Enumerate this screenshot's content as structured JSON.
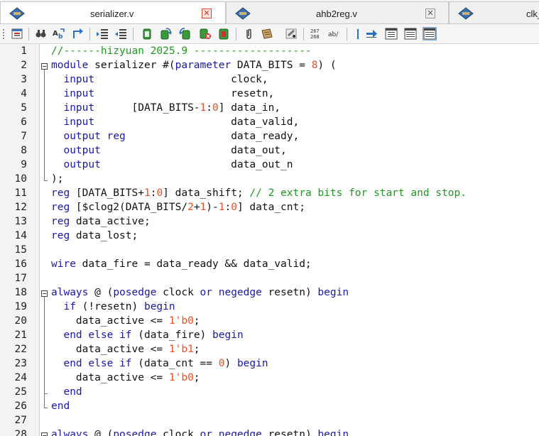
{
  "tabs": [
    {
      "label": "serializer.v",
      "active": true,
      "close_style": "red"
    },
    {
      "label": "ahb2reg.v",
      "active": false,
      "close_style": "grey"
    },
    {
      "label": "clk_",
      "active": false,
      "close_style": "none"
    }
  ],
  "toolbar": {
    "icons": [
      "new-file-icon",
      "find-icon",
      "replace-icon",
      "goto-icon",
      "indent-icon",
      "outdent-icon",
      "copy-icon",
      "paste-icon",
      "cut-icon",
      "delete-icon",
      "clipboard-icon",
      "attach-icon",
      "scroll-icon",
      "tag-icon",
      "hex-icon",
      "ab-icon",
      "line-icon",
      "arrow-right-icon",
      "split-view-icon",
      "list-view-icon",
      "wrap-view-icon"
    ],
    "hex_label_top": "267",
    "hex_label_bottom": "268",
    "ab_label": "ab/"
  },
  "colors": {
    "keyword": "#1a1aa6",
    "number": "#e8502a",
    "comment": "#1f9a1f",
    "text": "#111111"
  },
  "editor": {
    "lines": [
      {
        "n": "1",
        "tokens": [
          {
            "t": "//------hizyuan 2025.9 -------------------",
            "c": "cm"
          }
        ]
      },
      {
        "n": "2",
        "tokens": [
          {
            "t": "module",
            "c": "kw"
          },
          {
            "t": " serializer #("
          },
          {
            "t": "parameter",
            "c": "kw"
          },
          {
            "t": " DATA_BITS = "
          },
          {
            "t": "8",
            "c": "num"
          },
          {
            "t": ") ("
          }
        ]
      },
      {
        "n": "3",
        "tokens": [
          {
            "t": "  "
          },
          {
            "t": "input",
            "c": "kw"
          },
          {
            "t": "                      clock,"
          }
        ]
      },
      {
        "n": "4",
        "tokens": [
          {
            "t": "  "
          },
          {
            "t": "input",
            "c": "kw"
          },
          {
            "t": "                      resetn,"
          }
        ]
      },
      {
        "n": "5",
        "tokens": [
          {
            "t": "  "
          },
          {
            "t": "input",
            "c": "kw"
          },
          {
            "t": "      [DATA_BITS-"
          },
          {
            "t": "1",
            "c": "num"
          },
          {
            "t": ":"
          },
          {
            "t": "0",
            "c": "num"
          },
          {
            "t": "] data_in,"
          }
        ]
      },
      {
        "n": "6",
        "tokens": [
          {
            "t": "  "
          },
          {
            "t": "input",
            "c": "kw"
          },
          {
            "t": "                      data_valid,"
          }
        ]
      },
      {
        "n": "7",
        "tokens": [
          {
            "t": "  "
          },
          {
            "t": "output",
            "c": "kw"
          },
          {
            "t": " "
          },
          {
            "t": "reg",
            "c": "kw"
          },
          {
            "t": "                 data_ready,"
          }
        ]
      },
      {
        "n": "8",
        "tokens": [
          {
            "t": "  "
          },
          {
            "t": "output",
            "c": "kw"
          },
          {
            "t": "                     data_out,"
          }
        ]
      },
      {
        "n": "9",
        "tokens": [
          {
            "t": "  "
          },
          {
            "t": "output",
            "c": "kw"
          },
          {
            "t": "                     data_out_n"
          }
        ]
      },
      {
        "n": "10",
        "tokens": [
          {
            "t": ");"
          }
        ]
      },
      {
        "n": "11",
        "tokens": [
          {
            "t": "reg",
            "c": "kw"
          },
          {
            "t": " [DATA_BITS+"
          },
          {
            "t": "1",
            "c": "num"
          },
          {
            "t": ":"
          },
          {
            "t": "0",
            "c": "num"
          },
          {
            "t": "] data_shift; "
          },
          {
            "t": "// 2 extra bits for start and stop.",
            "c": "cm"
          }
        ]
      },
      {
        "n": "12",
        "tokens": [
          {
            "t": "reg",
            "c": "kw"
          },
          {
            "t": " [$clog2(DATA_BITS/"
          },
          {
            "t": "2",
            "c": "num"
          },
          {
            "t": "+"
          },
          {
            "t": "1",
            "c": "num"
          },
          {
            "t": ")-"
          },
          {
            "t": "1",
            "c": "num"
          },
          {
            "t": ":"
          },
          {
            "t": "0",
            "c": "num"
          },
          {
            "t": "] data_cnt;"
          }
        ]
      },
      {
        "n": "13",
        "tokens": [
          {
            "t": "reg",
            "c": "kw"
          },
          {
            "t": " data_active;"
          }
        ]
      },
      {
        "n": "14",
        "tokens": [
          {
            "t": "reg",
            "c": "kw"
          },
          {
            "t": " data_lost;"
          }
        ]
      },
      {
        "n": "15",
        "tokens": []
      },
      {
        "n": "16",
        "tokens": [
          {
            "t": "wire",
            "c": "kw"
          },
          {
            "t": " data_fire = data_ready && data_valid;"
          }
        ]
      },
      {
        "n": "17",
        "tokens": []
      },
      {
        "n": "18",
        "tokens": [
          {
            "t": "always",
            "c": "kw"
          },
          {
            "t": " @ ("
          },
          {
            "t": "posedge",
            "c": "kw"
          },
          {
            "t": " clock "
          },
          {
            "t": "or",
            "c": "kw"
          },
          {
            "t": " "
          },
          {
            "t": "negedge",
            "c": "kw"
          },
          {
            "t": " resetn) "
          },
          {
            "t": "begin",
            "c": "kw"
          }
        ]
      },
      {
        "n": "19",
        "tokens": [
          {
            "t": "  "
          },
          {
            "t": "if",
            "c": "kw"
          },
          {
            "t": " (!resetn) "
          },
          {
            "t": "begin",
            "c": "kw"
          }
        ]
      },
      {
        "n": "20",
        "tokens": [
          {
            "t": "    data_active <= "
          },
          {
            "t": "1'b0",
            "c": "num"
          },
          {
            "t": ";"
          }
        ]
      },
      {
        "n": "21",
        "tokens": [
          {
            "t": "  "
          },
          {
            "t": "end",
            "c": "kw"
          },
          {
            "t": " "
          },
          {
            "t": "else",
            "c": "kw"
          },
          {
            "t": " "
          },
          {
            "t": "if",
            "c": "kw"
          },
          {
            "t": " (data_fire) "
          },
          {
            "t": "begin",
            "c": "kw"
          }
        ]
      },
      {
        "n": "22",
        "tokens": [
          {
            "t": "    data_active <= "
          },
          {
            "t": "1'b1",
            "c": "num"
          },
          {
            "t": ";"
          }
        ]
      },
      {
        "n": "23",
        "tokens": [
          {
            "t": "  "
          },
          {
            "t": "end",
            "c": "kw"
          },
          {
            "t": " "
          },
          {
            "t": "else",
            "c": "kw"
          },
          {
            "t": " "
          },
          {
            "t": "if",
            "c": "kw"
          },
          {
            "t": " (data_cnt == "
          },
          {
            "t": "0",
            "c": "num"
          },
          {
            "t": ") "
          },
          {
            "t": "begin",
            "c": "kw"
          }
        ]
      },
      {
        "n": "24",
        "tokens": [
          {
            "t": "    data_active <= "
          },
          {
            "t": "1'b0",
            "c": "num"
          },
          {
            "t": ";"
          }
        ]
      },
      {
        "n": "25",
        "tokens": [
          {
            "t": "  "
          },
          {
            "t": "end",
            "c": "kw"
          }
        ]
      },
      {
        "n": "26",
        "tokens": [
          {
            "t": "end",
            "c": "kw"
          }
        ]
      },
      {
        "n": "27",
        "tokens": []
      },
      {
        "n": "28",
        "tokens": [
          {
            "t": "always",
            "c": "kw"
          },
          {
            "t": " @ ("
          },
          {
            "t": "posedge",
            "c": "kw"
          },
          {
            "t": " clock "
          },
          {
            "t": "or",
            "c": "kw"
          },
          {
            "t": " "
          },
          {
            "t": "negedge",
            "c": "kw"
          },
          {
            "t": " resetn) "
          },
          {
            "t": "begin",
            "c": "kw"
          }
        ]
      }
    ]
  }
}
